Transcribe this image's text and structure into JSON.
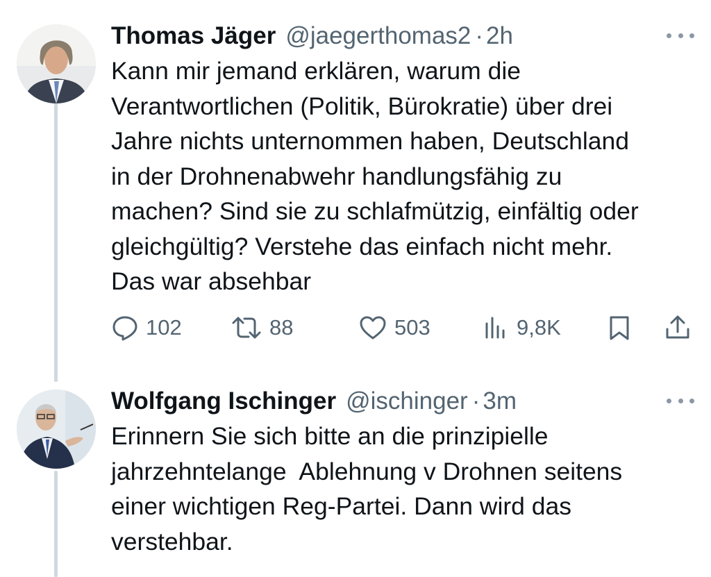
{
  "tweets": [
    {
      "author_name": "Thomas Jäger",
      "handle": "@jaegerthomas2",
      "separator": "·",
      "time": "2h",
      "text_lines": [
        "Kann mir jemand erklären, warum die",
        "Verantwortlichen (Politik, Bürokratie) über drei",
        "Jahre nichts unternommen haben, Deutschland",
        "in der Drohnenabwehr handlungsfähig zu",
        "machen? Sind sie zu schlafmützig, einfältig oder",
        "gleichgültig? Verstehe das einfach nicht mehr.",
        "Das war absehbar"
      ],
      "stats": {
        "replies": "102",
        "retweets": "88",
        "likes": "503",
        "views": "9,8K"
      }
    },
    {
      "author_name": "Wolfgang Ischinger",
      "handle": "@ischinger",
      "separator": "·",
      "time": "3m",
      "text_lines": [
        "Erinnern Sie sich bitte an die prinzipielle",
        "jahrzehntelange  Ablehnung v Drohnen seitens",
        "einer wichtigen Reg-Partei. Dann wird das",
        "verstehbar."
      ]
    }
  ],
  "icons": {
    "reply": "reply-icon",
    "retweet": "retweet-icon",
    "like": "heart-icon",
    "views": "views-icon",
    "bookmark": "bookmark-icon",
    "share": "share-icon",
    "more": "more-icon"
  },
  "colors": {
    "text": "#0f1419",
    "secondary": "#536471",
    "thread_line": "#cfd9de"
  }
}
